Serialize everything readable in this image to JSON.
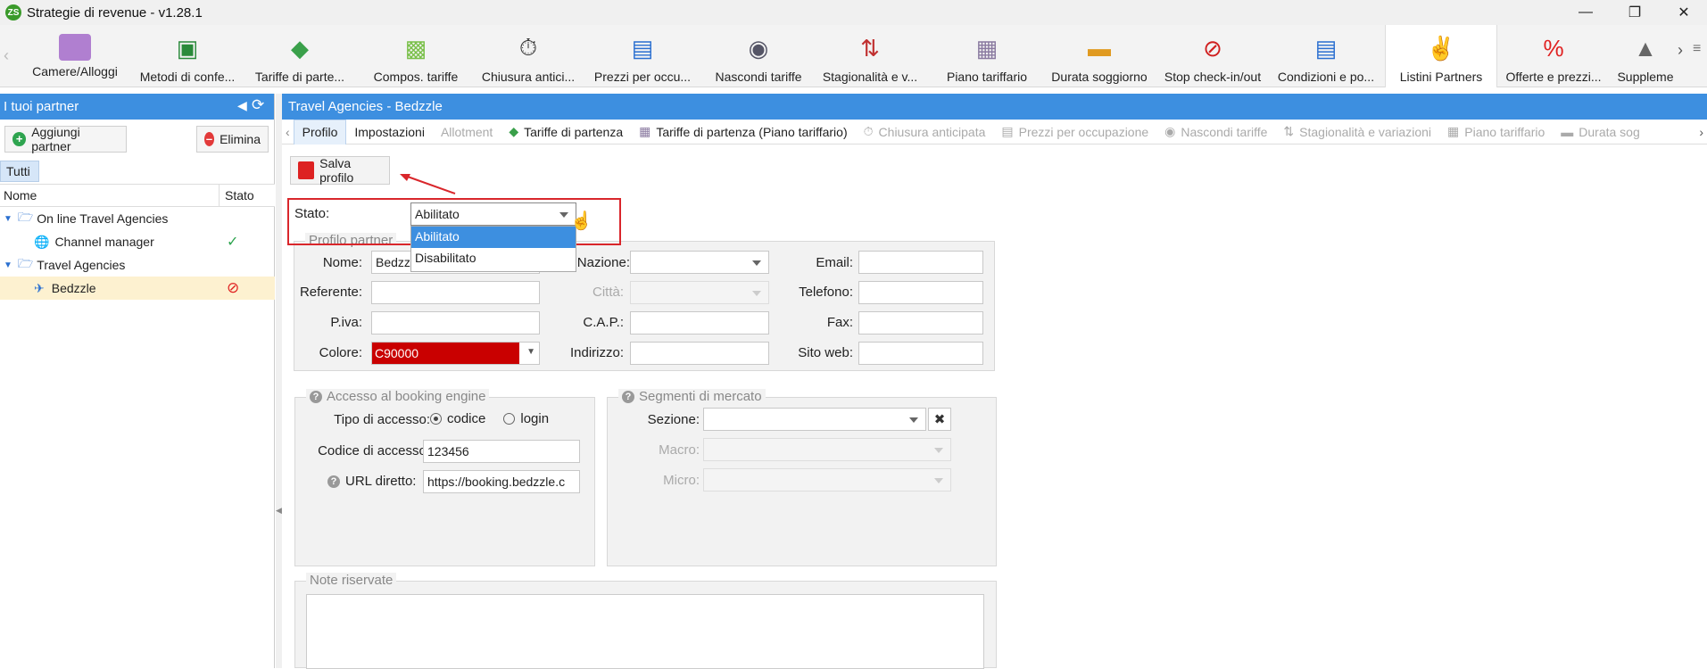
{
  "app": {
    "title": "Strategie di revenue - v1.28.1",
    "logo_text": "ZS"
  },
  "toolbar": {
    "items": [
      {
        "label": "Camere/Alloggi",
        "icon": "bed-icon"
      },
      {
        "label": "Metodi di confe...",
        "icon": "money-icon"
      },
      {
        "label": "Tariffe di parte...",
        "icon": "tag-icon"
      },
      {
        "label": "Compos. tariffe",
        "icon": "puzzle-icon"
      },
      {
        "label": "Chiusura antici...",
        "icon": "stopwatch-lock-icon"
      },
      {
        "label": "Prezzi per occu...",
        "icon": "bar-chart-icon"
      },
      {
        "label": "Nascondi tariffe",
        "icon": "hidden-calendar-icon"
      },
      {
        "label": "Stagionalità e v...",
        "icon": "calendar-arrows-icon"
      },
      {
        "label": "Piano tariffario",
        "icon": "grid-calendar-icon"
      },
      {
        "label": "Durata soggiorno",
        "icon": "ruler-calendar-icon"
      },
      {
        "label": "Stop check-in/out",
        "icon": "stop-calendar-icon"
      },
      {
        "label": "Condizioni e po...",
        "icon": "document-icon"
      },
      {
        "label": "Listini Partners",
        "icon": "handshake-icon"
      },
      {
        "label": "Offerte e prezzi...",
        "icon": "percent-badge-icon"
      },
      {
        "label": "Suppleme",
        "icon": "bell-icon"
      }
    ],
    "active": "Listini Partners"
  },
  "left": {
    "title": "I tuoi partner",
    "add_label": "Aggiungi partner",
    "delete_label": "Elimina",
    "tab_all": "Tutti",
    "col_name": "Nome",
    "col_status": "Stato",
    "rows": [
      {
        "label": "On line Travel Agencies",
        "type": "folder"
      },
      {
        "label": "Channel manager",
        "type": "globe",
        "status": "✓"
      },
      {
        "label": "Travel Agencies",
        "type": "folder"
      },
      {
        "label": "Bedzzle",
        "type": "plane",
        "status": "⊘"
      }
    ]
  },
  "right": {
    "title": "Travel Agencies - Bedzzle",
    "tabs": [
      {
        "label": "Profilo",
        "state": "selected"
      },
      {
        "label": "Impostazioni",
        "state": "normal"
      },
      {
        "label": "Allotment",
        "state": "disabled"
      },
      {
        "label": "Tariffe di partenza",
        "state": "normal"
      },
      {
        "label": "Tariffe di partenza (Piano tariffario)",
        "state": "normal"
      },
      {
        "label": "Chiusura anticipata",
        "state": "disabled"
      },
      {
        "label": "Prezzi per occupazione",
        "state": "disabled"
      },
      {
        "label": "Nascondi tariffe",
        "state": "disabled"
      },
      {
        "label": "Stagionalità e variazioni",
        "state": "disabled"
      },
      {
        "label": "Piano tariffario",
        "state": "disabled"
      },
      {
        "label": "Durata sog",
        "state": "disabled"
      }
    ],
    "save_label": "Salva profilo",
    "stato_label": "Stato:",
    "stato_value": "Abilitato",
    "stato_options": [
      "Abilitato",
      "Disabilitato"
    ],
    "profile": {
      "legend": "Profilo partner",
      "nome_label": "Nome:",
      "nome_value": "Bedzzle",
      "nazione_label": "Nazione:",
      "email_label": "Email:",
      "referente_label": "Referente:",
      "citta_label": "Città:",
      "telefono_label": "Telefono:",
      "piva_label": "P.iva:",
      "cap_label": "C.A.P.:",
      "fax_label": "Fax:",
      "colore_label": "Colore:",
      "colore_value": "C90000",
      "indirizzo_label": "Indirizzo:",
      "sitoweb_label": "Sito web:"
    },
    "booking": {
      "legend": "Accesso al booking engine",
      "tipo_label": "Tipo di accesso:",
      "opt_codice": "codice",
      "opt_login": "login",
      "codice_label": "Codice di accesso:",
      "codice_value": "123456",
      "url_label": "URL diretto:",
      "url_value": "https://booking.bedzzle.c"
    },
    "segmenti": {
      "legend": "Segmenti di mercato",
      "sezione_label": "Sezione:",
      "macro_label": "Macro:",
      "micro_label": "Micro:"
    },
    "note_legend": "Note riservate"
  },
  "colors": {
    "accent": "#3d8fe0",
    "partner_color": "#C90000",
    "annotation_red": "#d9262b"
  }
}
